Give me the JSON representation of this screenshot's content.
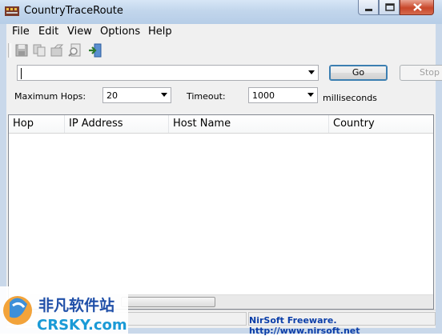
{
  "window": {
    "title": "CountryTraceRoute"
  },
  "menu": {
    "items": [
      "File",
      "Edit",
      "View",
      "Options",
      "Help"
    ]
  },
  "toolbar": {
    "icons": [
      "save-icon",
      "copy-icon",
      "properties-icon",
      "find-icon",
      "exit-icon"
    ]
  },
  "address": {
    "value": ""
  },
  "buttons": {
    "go": "Go",
    "stop": "Stop"
  },
  "options": {
    "hops_label": "Maximum Hops:",
    "hops_value": "20",
    "timeout_label": "Timeout:",
    "timeout_value": "1000",
    "timeout_unit": "milliseconds"
  },
  "table": {
    "columns": [
      "Hop",
      "IP Address",
      "Host Name",
      "Country"
    ],
    "rows": []
  },
  "status": {
    "text": "NirSoft Freeware.  http://www.nirsoft.net"
  },
  "watermark": {
    "text": "CRSKY.com",
    "chinese": "非凡软件站"
  }
}
